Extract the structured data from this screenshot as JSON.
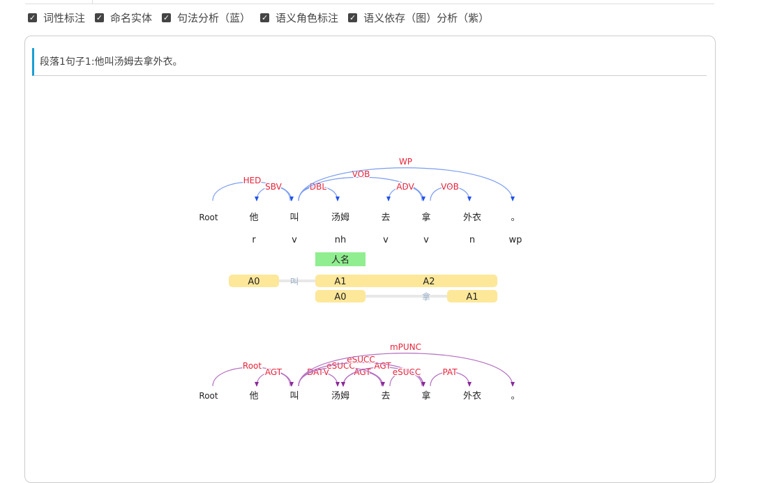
{
  "options": [
    {
      "label": "词性标注",
      "checked": true
    },
    {
      "label": "命名实体",
      "checked": true
    },
    {
      "label": "句法分析（蓝）",
      "checked": true
    },
    {
      "label": "语义角色标注",
      "checked": true
    },
    {
      "label": "语义依存（图）分析（紫）",
      "checked": true
    }
  ],
  "sentence_header": "段落1句子1:他叫汤姆去拿外衣。",
  "tokens": [
    "Root",
    "他",
    "叫",
    "汤姆",
    "去",
    "拿",
    "外衣",
    "。"
  ],
  "pos_tags": [
    "r",
    "v",
    "nh",
    "v",
    "v",
    "n",
    "wp"
  ],
  "ner": [
    {
      "label": "人名",
      "token": 3
    }
  ],
  "syntax_arcs": [
    {
      "label": "HED",
      "from": 0,
      "to": 2
    },
    {
      "label": "SBV",
      "from": 2,
      "to": 1
    },
    {
      "label": "DBL",
      "from": 2,
      "to": 3
    },
    {
      "label": "VOB",
      "from": 2,
      "to": 5
    },
    {
      "label": "WP",
      "from": 2,
      "to": 7
    },
    {
      "label": "ADV",
      "from": 5,
      "to": 4
    },
    {
      "label": "VOB",
      "from": 5,
      "to": 6
    }
  ],
  "srl_rows": [
    {
      "predicate": "叫",
      "pred_token": 2,
      "args": [
        {
          "label": "A0",
          "start": 1,
          "end": 1
        },
        {
          "label": "A1",
          "start": 3,
          "end": 3
        },
        {
          "label": "A2",
          "start": 4,
          "end": 6
        }
      ]
    },
    {
      "predicate": "拿",
      "pred_token": 5,
      "args": [
        {
          "label": "A0",
          "start": 3,
          "end": 3
        },
        {
          "label": "A1",
          "start": 6,
          "end": 6
        }
      ]
    }
  ],
  "semantic_arcs": [
    {
      "label": "Root",
      "from": 0,
      "to": 2
    },
    {
      "label": "AGT",
      "from": 2,
      "to": 1
    },
    {
      "label": "DATV",
      "from": 2,
      "to": 3
    },
    {
      "label": "AGT",
      "from": 4,
      "to": 3
    },
    {
      "label": "eSUCC",
      "from": 2,
      "to": 4
    },
    {
      "label": "AGT",
      "from": 5,
      "to": 3
    },
    {
      "label": "eSUCC",
      "from": 2,
      "to": 5
    },
    {
      "label": "eSUCC",
      "from": 4,
      "to": 5
    },
    {
      "label": "PAT",
      "from": 5,
      "to": 6
    },
    {
      "label": "mPUNC",
      "from": 2,
      "to": 7
    }
  ],
  "colors": {
    "syntax": "#7b9cf0",
    "semantic": "#b46fc0",
    "arc_label": "#e8233a",
    "arrow_syntax": "#2254e6",
    "arrow_semantic": "#8a2a9a",
    "ner_fill": "#90ee90",
    "srl_fill": "#fde89a",
    "accent": "#1a9ed6"
  }
}
